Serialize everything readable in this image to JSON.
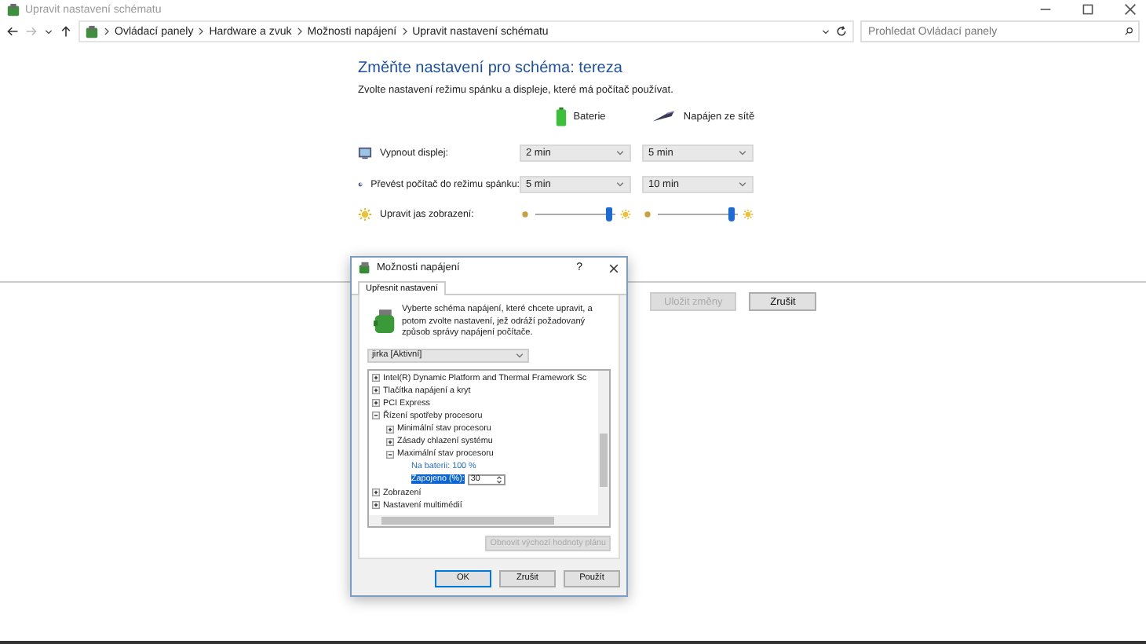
{
  "window": {
    "title": "Upravit nastavení schématu"
  },
  "address": {
    "crumbs": [
      "Ovládací panely",
      "Hardware a zvuk",
      "Možnosti napájení",
      "Upravit nastavení schématu"
    ],
    "search": {
      "placeholder": "Prohledat Ovládací panely"
    }
  },
  "page": {
    "heading": "Změňte nastavení pro schéma: tereza",
    "subheading": "Zvolte nastavení režimu spánku a displeje, které má počítač používat.",
    "columns": [
      {
        "kind": "battery",
        "label": "Baterie"
      },
      {
        "kind": "plug",
        "label": "Napájen ze sítě"
      }
    ],
    "settings": [
      {
        "kind": "dropdown",
        "label": "Vypnout displej:",
        "values": [
          {
            "value": "2 min"
          },
          {
            "value": "5 min"
          }
        ]
      },
      {
        "kind": "dropdown",
        "label": "Převést počítač do režimu spánku:",
        "values": [
          {
            "value": "5 min"
          },
          {
            "value": "10 min"
          }
        ]
      },
      {
        "kind": "slider",
        "label": "Upravit jas zobrazení:",
        "values": [
          {
            "level": 0.92
          },
          {
            "level": 0.92
          }
        ]
      }
    ],
    "buttons": [
      {
        "label": "Uložit změny",
        "disabled": true
      },
      {
        "label": "Zrušit",
        "disabled": false
      }
    ]
  },
  "dialog": {
    "title": "Možnosti napájení",
    "help": "?",
    "tabs": [
      {
        "label": "Upřesnit nastavení",
        "selected": true
      }
    ],
    "intro": "Vyberte schéma napájení, které chcete upravit, a potom zvolte nastavení, jež odráží požadovaný způsob správy napájení počítače.",
    "scheme": "jirka [Aktivní]",
    "tree": [
      {
        "label": "Intel(R) Dynamic Platform and Thermal Framework Sc",
        "expanded": false
      },
      {
        "label": "Tlačítka napájení a kryt",
        "expanded": false
      },
      {
        "label": "PCI Express",
        "expanded": false
      },
      {
        "label": "Řízení spotřeby procesoru",
        "expanded": true,
        "children": [
          {
            "label": "Minimální stav procesoru",
            "expanded": false
          },
          {
            "label": "Zásady chlazení systému",
            "expanded": false
          },
          {
            "label": "Maximální stav procesoru",
            "expanded": true,
            "children": [
              {
                "kind": "link",
                "label": "Na baterii: 100 %"
              },
              {
                "kind": "editor",
                "label": "Zapojeno (%):",
                "value": "30",
                "selected": true
              }
            ]
          }
        ]
      },
      {
        "label": "Zobrazení",
        "expanded": false
      },
      {
        "label": "Nastavení multimédií",
        "expanded": false
      }
    ],
    "restore": {
      "label": "Obnovit výchozí hodnoty plánu",
      "disabled": true
    },
    "buttons": [
      {
        "label": "OK",
        "default": true
      },
      {
        "label": "Zrušit",
        "default": false
      },
      {
        "label": "Použít",
        "default": false
      }
    ]
  }
}
